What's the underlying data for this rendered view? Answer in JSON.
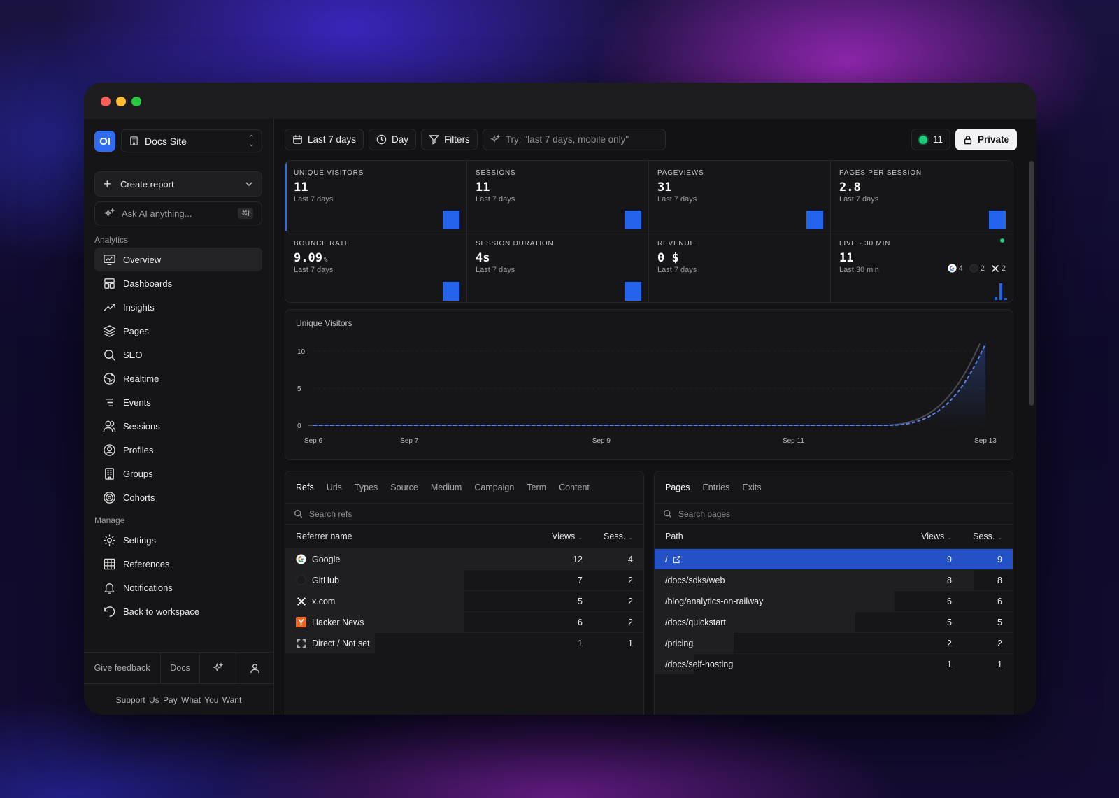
{
  "sidebar": {
    "logo": "OI",
    "site": "Docs Site",
    "create_report": "Create report",
    "ask_ai": "Ask AI anything...",
    "ask_ai_shortcut": "⌘J",
    "analytics_label": "Analytics",
    "manage_label": "Manage",
    "analytics_items": [
      "Overview",
      "Dashboards",
      "Insights",
      "Pages",
      "SEO",
      "Realtime",
      "Events",
      "Sessions",
      "Profiles",
      "Groups",
      "Cohorts"
    ],
    "manage_items": [
      "Settings",
      "References",
      "Notifications",
      "Back to workspace"
    ],
    "footer": {
      "feedback": "Give feedback",
      "docs": "Docs"
    },
    "support": "Support Us  Pay What You Want"
  },
  "topbar": {
    "range": "Last 7 days",
    "interval": "Day",
    "filters": "Filters",
    "ai_placeholder": "Try: \"last 7 days, mobile only\"",
    "live_count": "11",
    "private": "Private"
  },
  "stats": [
    {
      "label": "Unique Visitors",
      "value": "11",
      "suffix": "",
      "sub": "Last 7 days"
    },
    {
      "label": "Sessions",
      "value": "11",
      "suffix": "",
      "sub": "Last 7 days"
    },
    {
      "label": "Pageviews",
      "value": "31",
      "suffix": "",
      "sub": "Last 7 days"
    },
    {
      "label": "Pages per session",
      "value": "2.8",
      "suffix": "",
      "sub": "Last 7 days"
    },
    {
      "label": "Bounce rate",
      "value": "9.09",
      "suffix": "%",
      "sub": "Last 7 days"
    },
    {
      "label": "Session duration",
      "value": "4s",
      "suffix": "",
      "sub": "Last 7 days"
    },
    {
      "label": "Revenue",
      "value": "0 $",
      "suffix": "",
      "sub": "Last 7 days"
    },
    {
      "label": "Live · 30 min",
      "value": "11",
      "suffix": "",
      "sub": "Last 30 min"
    }
  ],
  "live_refs": [
    {
      "icon": "google-icon",
      "count": "4"
    },
    {
      "icon": "github-icon",
      "count": "2"
    },
    {
      "icon": "x-icon",
      "count": "2"
    }
  ],
  "chart_data": {
    "type": "line",
    "title": "Unique Visitors",
    "x": [
      "Sep 6",
      "Sep 7",
      "Sep 8",
      "Sep 9",
      "Sep 10",
      "Sep 11",
      "Sep 12",
      "Sep 13"
    ],
    "x_tick_labels": [
      "Sep 6",
      "Sep 7",
      "Sep 9",
      "Sep 11",
      "Sep 13"
    ],
    "series": [
      {
        "values": [
          0,
          0,
          0,
          0,
          0,
          0,
          0,
          11
        ]
      }
    ],
    "y_ticks": [
      0,
      5,
      10
    ],
    "ylim": [
      0,
      12
    ],
    "line_color": "#5b7fe8",
    "grid": true
  },
  "refs_panel": {
    "tabs": [
      "Refs",
      "Urls",
      "Types",
      "Source",
      "Medium",
      "Campaign",
      "Term",
      "Content"
    ],
    "search_placeholder": "Search refs",
    "headers": [
      "Referrer name",
      "Views",
      "Sess."
    ],
    "rows": [
      {
        "name": "Google",
        "icon": "google-icon",
        "views": "12",
        "sess": "4",
        "share": 1.0
      },
      {
        "name": "GitHub",
        "icon": "github-icon",
        "views": "7",
        "sess": "2",
        "share": 0.5
      },
      {
        "name": "x.com",
        "icon": "x-icon",
        "views": "5",
        "sess": "2",
        "share": 0.5
      },
      {
        "name": "Hacker News",
        "icon": "hackernews-icon",
        "views": "6",
        "sess": "2",
        "share": 0.5
      },
      {
        "name": "Direct / Not set",
        "icon": "direct-icon",
        "views": "1",
        "sess": "1",
        "share": 0.25
      }
    ]
  },
  "pages_panel": {
    "tabs": [
      "Pages",
      "Entries",
      "Exits"
    ],
    "search_placeholder": "Search pages",
    "headers": [
      "Path",
      "Views",
      "Sess."
    ],
    "rows": [
      {
        "path": "/",
        "views": "9",
        "sess": "9",
        "share": 1.0
      },
      {
        "path": "/docs/sdks/web",
        "views": "8",
        "sess": "8",
        "share": 0.89
      },
      {
        "path": "/blog/analytics-on-railway",
        "views": "6",
        "sess": "6",
        "share": 0.67
      },
      {
        "path": "/docs/quickstart",
        "views": "5",
        "sess": "5",
        "share": 0.56
      },
      {
        "path": "/pricing",
        "views": "2",
        "sess": "2",
        "share": 0.22
      },
      {
        "path": "/docs/self-hosting",
        "views": "1",
        "sess": "1",
        "share": 0.11
      }
    ]
  }
}
